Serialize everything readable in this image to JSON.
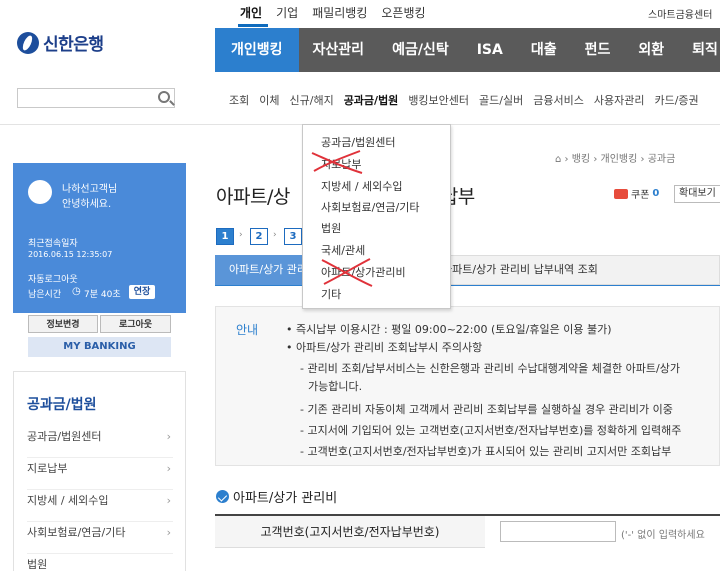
{
  "header": {
    "top_tabs": [
      "개인",
      "기업",
      "패밀리뱅킹",
      "오픈뱅킹"
    ],
    "smart_center": "스마트금융센터",
    "logo_text": "신한은행",
    "main_nav": [
      "개인뱅킹",
      "자산관리",
      "예금/신탁",
      "ISA",
      "대출",
      "펀드",
      "외환",
      "퇴직"
    ],
    "sub_nav": [
      "조회",
      "이체",
      "신규/해지",
      "공과금/법원",
      "뱅킹보안센터",
      "골드/실버",
      "금융서비스",
      "사용자관리",
      "카드/증권"
    ]
  },
  "left_panel": {
    "greeting_line1": "나하선고객님",
    "greeting_line2": "안녕하세요.",
    "last_login_label": "최근접속일자",
    "last_login_value": "2016.06.15 12:35:07",
    "auto_logout_label": "자동로그아웃",
    "remaining_label": "남은시간",
    "remaining_value": "7분 40초",
    "extend_button": "연장",
    "info_button": "정보변경",
    "logout_button": "로그아웃",
    "my_banking": "MY BANKING",
    "menu_title": "공과금/법원",
    "menu_items": [
      "공과금/법원센터",
      "지로납부",
      "지방세 / 세외수입",
      "사회보험료/연금/기타",
      "법원"
    ]
  },
  "content": {
    "breadcrumb": [
      "뱅킹",
      "개인뱅킹",
      "공과금"
    ],
    "page_title": "아파트/상가 관리비 납부",
    "page_title_visible_left": "아파트/상",
    "page_title_visible_right": "납부",
    "coupon_label": "쿠폰",
    "coupon_count": "0",
    "zoom_button": "확대보기",
    "steps": [
      "1",
      "2",
      "3"
    ],
    "tab_active": "아파트/상가 관리비",
    "tab_inactive": "아파트/상가 관리비 납부내역 조회",
    "notice_label": "안내",
    "notice_lines": [
      "즉시납부 이용시간 : 평일 09:00~22:00 (토요일/휴일은 이용 불가)",
      "아파트/상가 관리비 조회납부시 주의사항"
    ],
    "notice_sublines": [
      "관리비 조회/납부서비스는 신한은행과 관리비 수납대행계약을 체결한 아파트/상가",
      "가능합니다.",
      "기존 관리비 자동이체 고객께서 관리비 조회납부를 실행하실 경우 관리비가 이중",
      "고지서에 기입되어 있는 고객번호(고지서번호/전자납부번호)를 정확하게 입력해주",
      "고객번호(고지서번호/전자납부번호)가 표시되어 있는 관리비 고지서만 조회납부"
    ],
    "section_title": "아파트/상가 관리비",
    "form_label": "고객번호(고지서번호/전자납부번호)",
    "form_hint": "('-' 없이 입력하세요"
  },
  "dropdown": {
    "items": [
      "공과금/법원센터",
      "지로납부",
      "지방세 / 세외수입",
      "사회보험료/연금/기타",
      "법원",
      "국세/관세",
      "아파트/상가관리비",
      "기타"
    ]
  }
}
